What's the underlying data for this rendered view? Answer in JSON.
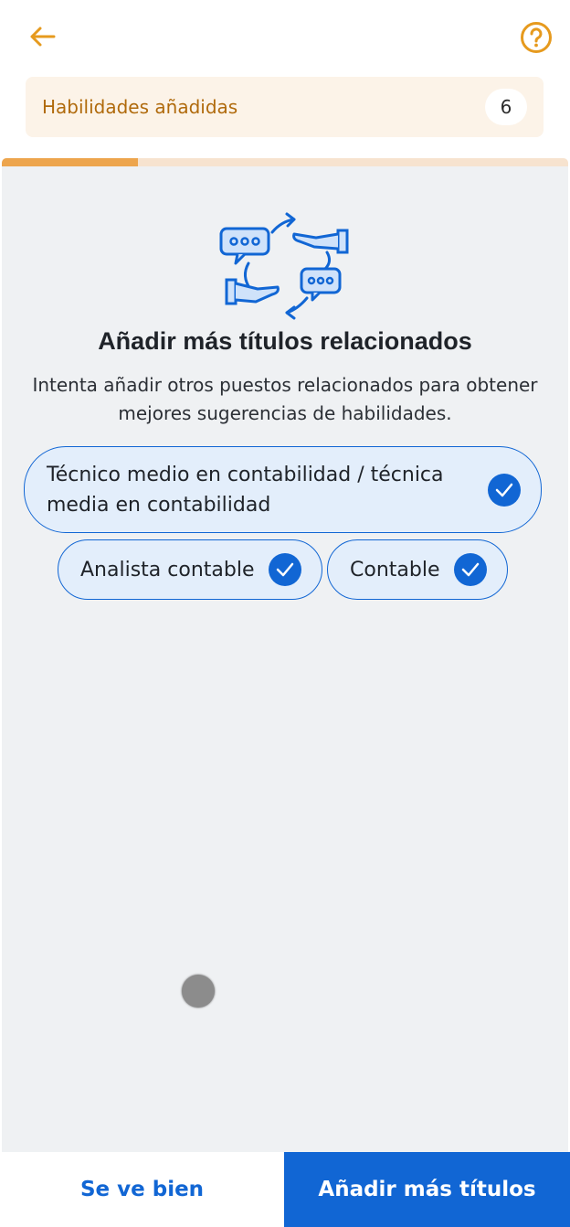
{
  "colors": {
    "accent_orange": "#e69a1e",
    "primary_blue": "#1166d4",
    "banner_bg": "#fcf3e8",
    "content_bg": "#eff1f3"
  },
  "header": {
    "back_icon": "arrow-left-icon",
    "help_icon": "question-circle-icon"
  },
  "skills_banner": {
    "label": "Habilidades añadidas",
    "count": "6"
  },
  "progress": {
    "fraction": 0.24
  },
  "main": {
    "illustration_icon": "conversation-handshake-icon",
    "heading": "Añadir más títulos relacionados",
    "description": "Intenta añadir otros puestos relacionados para obtener mejores sugerencias de habilidades.",
    "titles": [
      {
        "label": "Técnico medio en contabilidad / técnica media en contabilidad",
        "selected": true
      },
      {
        "label": "Analista contable",
        "selected": true
      },
      {
        "label": "Contable",
        "selected": true
      }
    ]
  },
  "footer": {
    "secondary_button": "Se ve bien",
    "primary_button": "Añadir más títulos"
  }
}
